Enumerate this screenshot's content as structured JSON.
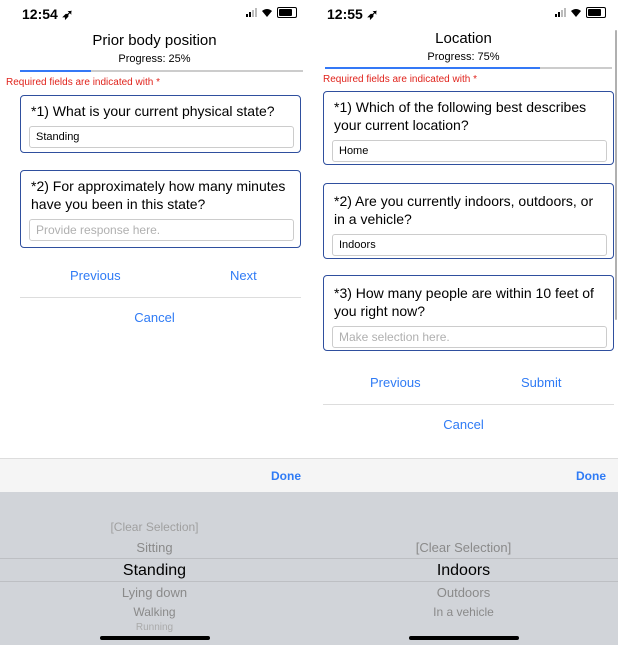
{
  "left": {
    "status": {
      "time": "12:54 ➶"
    },
    "header": {
      "title": "Prior body position",
      "progress": "Progress:  25%"
    },
    "progress_value": 0.25,
    "required_note": "Required fields are indicated with *",
    "questions": [
      {
        "text": "*1) What is your current physical state?",
        "value": "Standing",
        "placeholder": ""
      },
      {
        "text": "*2) For approximately how many minutes have you been in this state?",
        "value": "",
        "placeholder": "Provide response here."
      }
    ],
    "nav": {
      "previous": "Previous",
      "next": "Next"
    },
    "cancel": "Cancel",
    "toolbar": {
      "done": "Done"
    },
    "picker": {
      "options": [
        "[Clear Selection]",
        "Sitting",
        "Standing",
        "Lying down",
        "Walking",
        "Running"
      ],
      "selected": "Standing"
    }
  },
  "right": {
    "status": {
      "time": "12:55 ➶"
    },
    "header": {
      "title": "Location",
      "progress": "Progress:  75%"
    },
    "progress_value": 0.75,
    "required_note": "Required fields are indicated with *",
    "questions": [
      {
        "text": "*1) Which of the following best describes your current location?",
        "value": "Home",
        "placeholder": ""
      },
      {
        "text": "*2) Are you currently indoors, outdoors, or in a vehicle?",
        "value": "Indoors",
        "placeholder": ""
      },
      {
        "text": "*3) How many people are within 10 feet of you right now?",
        "value": "",
        "placeholder": "Make selection here."
      }
    ],
    "nav": {
      "previous": "Previous",
      "submit": "Submit"
    },
    "cancel": "Cancel",
    "toolbar": {
      "done": "Done"
    },
    "picker": {
      "options": [
        "[Clear Selection]",
        "Indoors",
        "Outdoors",
        "In a vehicle"
      ],
      "selected": "Indoors"
    }
  },
  "colors": {
    "accent": "#2f7bf5",
    "required": "#e0231c",
    "card_border": "#2f4f9e",
    "picker_bg": "#d1d4d9"
  }
}
